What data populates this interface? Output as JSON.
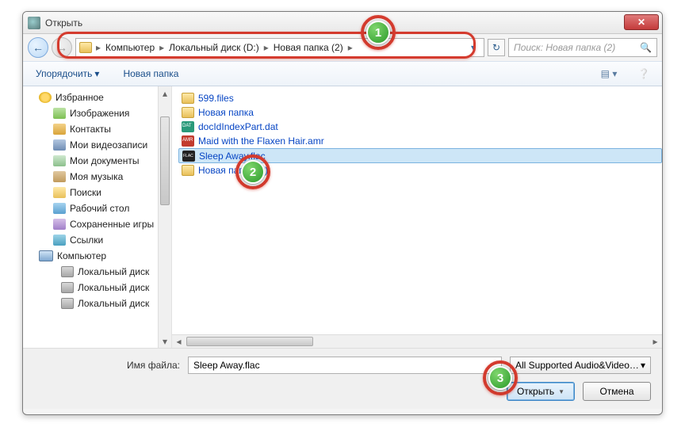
{
  "window": {
    "title": "Открыть"
  },
  "nav": {
    "segments": [
      "Компьютер",
      "Локальный диск (D:)",
      "Новая папка (2)"
    ],
    "search_placeholder": "Поиск: Новая папка (2)"
  },
  "toolbar": {
    "organize": "Упорядочить",
    "newfolder": "Новая папка"
  },
  "tree": {
    "items": [
      {
        "icon": "star",
        "label": "Избранное",
        "indent": 0
      },
      {
        "icon": "img",
        "label": "Изображения",
        "indent": 1
      },
      {
        "icon": "contact",
        "label": "Контакты",
        "indent": 1
      },
      {
        "icon": "video",
        "label": "Мои видеозаписи",
        "indent": 1
      },
      {
        "icon": "doc",
        "label": "Мои документы",
        "indent": 1
      },
      {
        "icon": "music",
        "label": "Моя музыка",
        "indent": 1
      },
      {
        "icon": "search",
        "label": "Поиски",
        "indent": 1
      },
      {
        "icon": "desk",
        "label": "Рабочий стол",
        "indent": 1
      },
      {
        "icon": "save",
        "label": "Сохраненные игры",
        "indent": 1
      },
      {
        "icon": "link",
        "label": "Ссылки",
        "indent": 1
      },
      {
        "icon": "computer",
        "label": "Компьютер",
        "indent": 0
      },
      {
        "icon": "drive",
        "label": "Локальный диск",
        "indent": 2
      },
      {
        "icon": "drive",
        "label": "Локальный диск",
        "indent": 2
      },
      {
        "icon": "drive",
        "label": "Локальный диск",
        "indent": 2
      }
    ]
  },
  "files": {
    "items": [
      {
        "icon": "folder",
        "name": "599.files",
        "sel": false
      },
      {
        "icon": "folder",
        "name": "Новая папка",
        "sel": false
      },
      {
        "icon": "dat",
        "name": "docIdIndexPart.dat",
        "sel": false
      },
      {
        "icon": "amr",
        "name": "Maid with the Flaxen Hair.amr",
        "sel": false
      },
      {
        "icon": "flac",
        "name": "Sleep Away.flac",
        "sel": true
      },
      {
        "icon": "zip",
        "name": "Новая папка (2)",
        "sel": false
      }
    ]
  },
  "footer": {
    "filename_label": "Имя файла:",
    "filename_value": "Sleep Away.flac",
    "filter": "All Supported Audio&Video Files",
    "open": "Открыть",
    "cancel": "Отмена"
  },
  "callouts": {
    "c1": "1",
    "c2": "2",
    "c3": "3"
  }
}
